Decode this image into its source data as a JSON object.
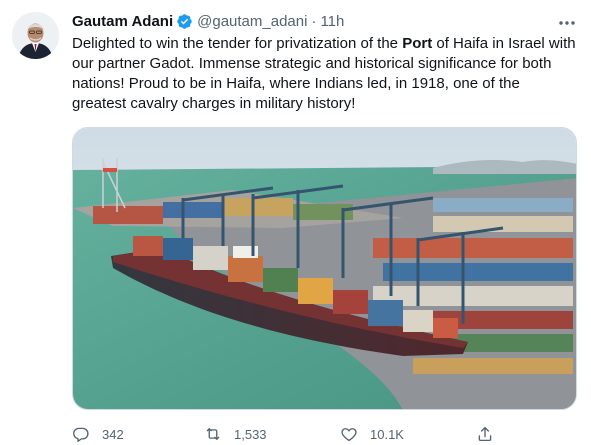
{
  "author": {
    "name": "Gautam Adani",
    "handle": "@gautam_adani",
    "separator": "·",
    "time": "11h"
  },
  "tweet": {
    "text_before_port": "Delighted to win the tender for privatization of the ",
    "port_bold": "Port",
    "text_after_port": " of Haifa in Israel with our partner Gadot. Immense strategic and historical significance for both nations! Proud to be in Haifa, where Indians led, in 1918, one of the greatest cavalry charges in military history!"
  },
  "actions": {
    "replies": "342",
    "retweets": "1,533",
    "likes": "10.1K"
  },
  "icons": {
    "verified": "verified-badge-icon",
    "more": "more-icon",
    "reply": "reply-icon",
    "retweet": "retweet-icon",
    "like": "heart-icon",
    "share": "share-icon"
  },
  "colors": {
    "verified_blue": "#1d9bf0",
    "secondary_text": "#536471",
    "primary_text": "#0f1419"
  }
}
